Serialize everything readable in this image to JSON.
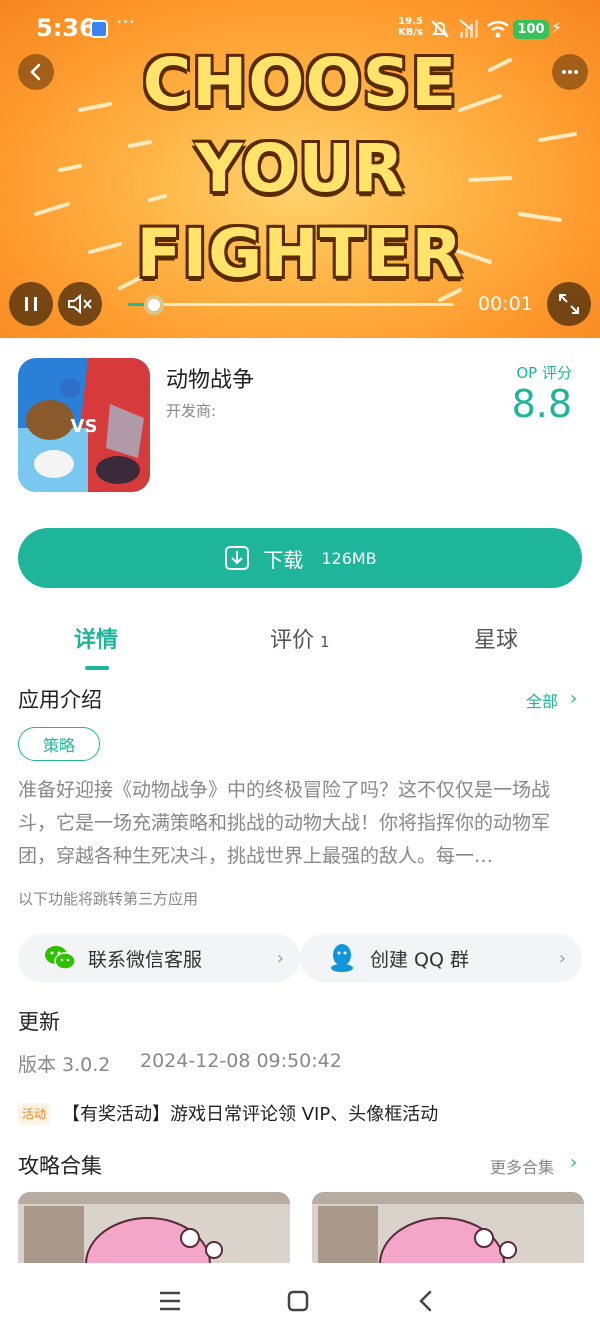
{
  "status_bar": {
    "time": "5:36",
    "overflow": "···",
    "net_speed_value": "19.5",
    "net_speed_unit": "KB/s",
    "battery": "100"
  },
  "video": {
    "title_lines": [
      "CHOOSE",
      "YOUR",
      "FIGHTER"
    ],
    "elapsed": "00:01",
    "progress": 0.08,
    "icons": [
      "back-icon",
      "more-icon",
      "pause-icon",
      "mute-icon",
      "fullscreen-icon"
    ]
  },
  "app": {
    "name": "动物战争",
    "developer_label": "开发商:",
    "rating_label": "OP 评分",
    "rating_value": "8.8",
    "icon_text": "VS"
  },
  "download": {
    "label": "下载",
    "size": "126MB"
  },
  "tabs": [
    {
      "label": "详情",
      "active": true
    },
    {
      "label": "评价",
      "count": "1"
    },
    {
      "label": "星球"
    }
  ],
  "intro": {
    "title": "应用介绍",
    "see_all": "全部",
    "tag": "策略",
    "text": "准备好迎接《动物战争》中的终极冒险了吗？这不仅仅是一场战斗，它是一场充满策略和挑战的动物大战！你将指挥你的动物军团，穿越各种生死决斗，挑战世界上最强的敌人。每一…",
    "third_party_note": "以下功能将跳转第三方应用"
  },
  "links": {
    "wechat": "联系微信客服",
    "qq": "创建 QQ 群"
  },
  "update": {
    "title": "更新",
    "version": "版本 3.0.2",
    "date": "2024-12-08 09:50:42"
  },
  "activity": {
    "badge": "活动",
    "text": "【有奖活动】游戏日常评论领 VIP、头像框活动"
  },
  "guides": {
    "title": "攻略合集",
    "more": "更多合集"
  },
  "colors": {
    "accent": "#1fb59a",
    "video_bg": "#ffa63a",
    "activity": "#f08a24"
  }
}
